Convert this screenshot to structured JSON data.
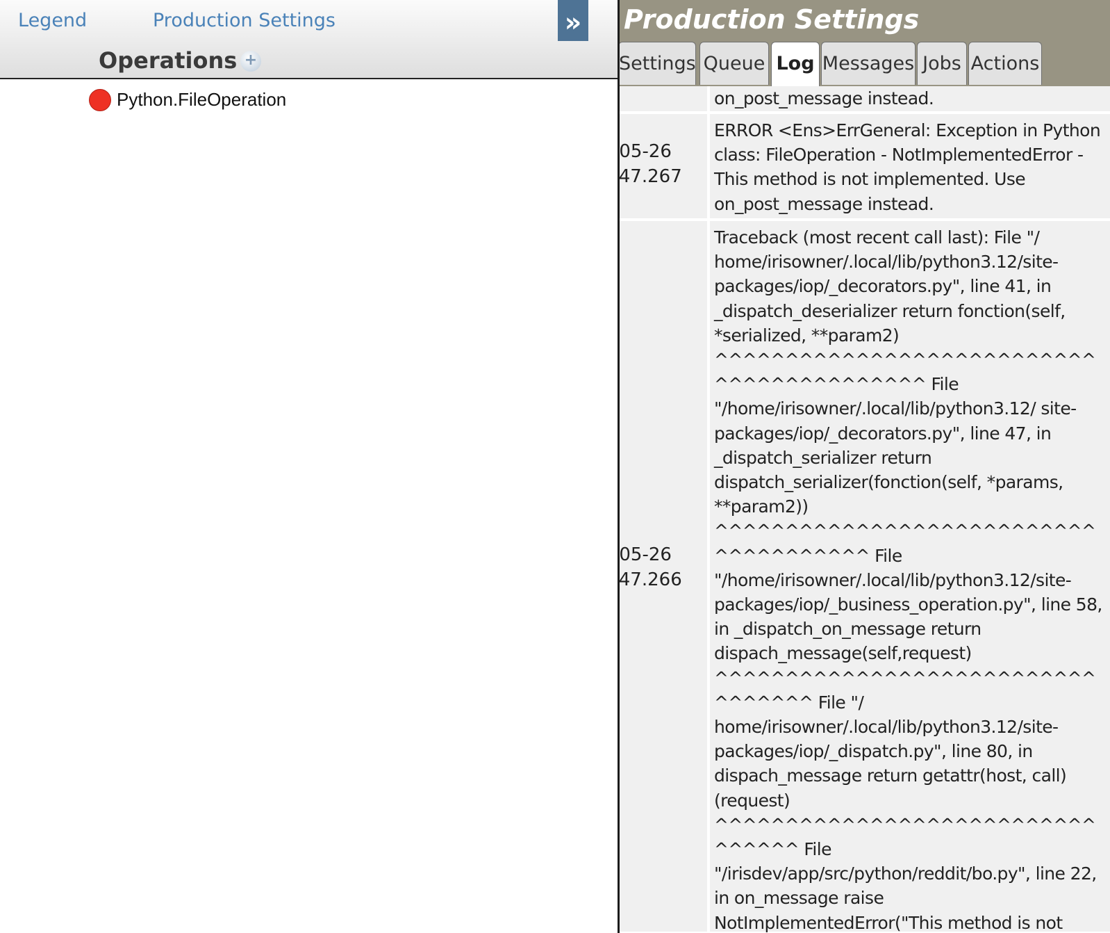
{
  "left": {
    "nav": {
      "legend": "Legend",
      "production_settings": "Production Settings"
    },
    "expand_glyph": "»",
    "operations_title": "Operations",
    "add_glyph": "+",
    "operations": [
      {
        "label": "Python.FileOperation",
        "status_color": "#ee3124"
      }
    ]
  },
  "right": {
    "title": "Production Settings",
    "tabs": [
      {
        "label": "Settings",
        "active": false
      },
      {
        "label": "Queue",
        "active": false
      },
      {
        "label": "Log",
        "active": true
      },
      {
        "label": "Messages",
        "active": false
      },
      {
        "label": "Jobs",
        "active": false
      },
      {
        "label": "Actions",
        "active": false
      }
    ],
    "log_entries": [
      {
        "time": "",
        "text": "on_post_message instead."
      },
      {
        "time": "-05-26\n:47.267",
        "text": "ERROR <Ens>ErrGeneral: Exception in Python class: FileOperation - NotImplementedError - This method is not implemented. Use on_post_message instead."
      },
      {
        "time": "-05-26\n:47.266",
        "text": "Traceback (most recent call last): File \"/ home/irisowner/.local/lib/python3.12/site-packages/iop/_decorators.py\", line 41, in _dispatch_deserializer return fonction(self, *serialized, **param2) ^^^^^^^^^^^^^^^^^^^^^^^^^^^^^^^^^^^^^^^^^^ File \"/home/irisowner/.local/lib/python3.12/ site-packages/iop/_decorators.py\", line 47, in _dispatch_serializer return dispatch_serializer(fonction(self, *params, **param2)) ^^^^^^^^^^^^^^^^^^^^^^^^^^^^^^^^^^^^^^ File \"/home/irisowner/.local/lib/python3.12/site-packages/iop/_business_operation.py\", line 58, in _dispatch_on_message return dispach_message(self,request) ^^^^^^^^^^^^^^^^^^^^^^^^^^^^^^^^^^ File \"/ home/irisowner/.local/lib/python3.12/site-packages/iop/_dispatch.py\", line 80, in dispach_message return getattr(host, call) (request) ^^^^^^^^^^^^^^^^^^^^^^^^^^^^^^^^^ File \"/irisdev/app/src/python/reddit/bo.py\", line 22, in on_message raise NotImplementedError(\"This method is not implemented. Use on_post_message instead.\") NotImplementedError: This method is not implemented. Use on_post_message instead."
      }
    ]
  }
}
